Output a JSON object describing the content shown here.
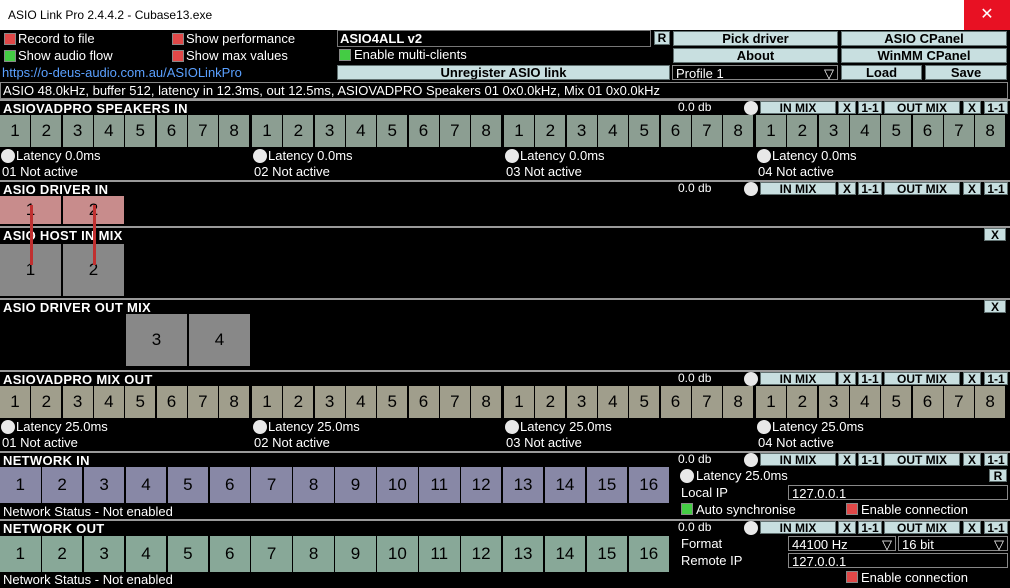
{
  "title": "ASIO Link Pro 2.4.4.2 - Cubase13.exe",
  "close": "✕",
  "top": {
    "record_to_file": "Record to file",
    "show_audio_flow": "Show audio flow",
    "show_performance": "Show performance",
    "show_max_values": "Show max values",
    "url": "https://o-deus-audio.com.au/ASIOLinkPro",
    "driver_name": "ASIO4ALL v2",
    "r": "R",
    "enable_multi": "Enable multi-clients",
    "unregister": "Unregister ASIO link",
    "pick_driver": "Pick driver",
    "asio_cpanel": "ASIO CPanel",
    "about": "About",
    "winmm": "WinMM CPanel",
    "profile": "Profile 1",
    "load": "Load",
    "save": "Save",
    "status": "ASIO 48.0kHz, buffer 512, latency in 12.3ms, out 12.5ms, ASIOVADPRO Speakers 01 0x0.0kHz, Mix 01 0x0.0kHz"
  },
  "ctrl": {
    "in_mix": "IN MIX",
    "x": "X",
    "one_one": "1-1",
    "out_mix": "OUT MIX",
    "db": "0.0 db"
  },
  "sections": {
    "speakers_in": "ASIOVADPRO SPEAKERS IN",
    "driver_in": "ASIO DRIVER IN",
    "host_in_mix": "ASIO HOST IN MIX",
    "driver_out_mix": "ASIO DRIVER OUT MIX",
    "mix_out": "ASIOVADPRO MIX OUT",
    "network_in": "NETWORK IN",
    "network_out": "NETWORK OUT"
  },
  "ch8": [
    "1",
    "2",
    "3",
    "4",
    "5",
    "6",
    "7",
    "8"
  ],
  "ch16": [
    "1",
    "2",
    "3",
    "4",
    "5",
    "6",
    "7",
    "8",
    "9",
    "10",
    "11",
    "12",
    "13",
    "14",
    "15",
    "16"
  ],
  "speakers": {
    "latency": "Latency 0.0ms",
    "groups": [
      "01 Not active",
      "02 Not active",
      "03 Not active",
      "04 Not active"
    ]
  },
  "mixout": {
    "latency": "Latency 25.0ms",
    "groups": [
      "01 Not active",
      "02 Not active",
      "03 Not active",
      "04 Not active"
    ]
  },
  "driver_in_ch": [
    "1",
    "2"
  ],
  "host_ch": [
    "1",
    "2"
  ],
  "driver_out_ch": [
    "3",
    "4"
  ],
  "network": {
    "status": "Network Status - Not enabled",
    "latency": "Latency 25.0ms",
    "local_ip_label": "Local IP",
    "local_ip": "127.0.0.1",
    "auto_sync": "Auto synchronise",
    "enable_conn": "Enable connection",
    "format_label": "Format",
    "format": "44100 Hz",
    "bits": "16 bit",
    "remote_ip_label": "Remote IP",
    "remote_ip": "127.0.0.1"
  },
  "colors": {
    "speakers": "#8c9e92",
    "mixout": "#a09e8c",
    "netin": "#8888a6",
    "netout": "#88a898",
    "button": "#c8dfe0"
  }
}
